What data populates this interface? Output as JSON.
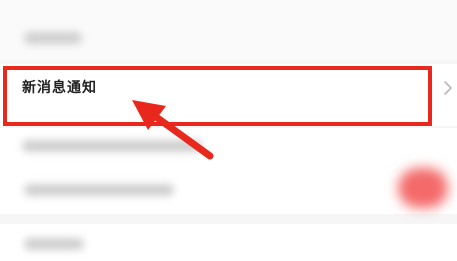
{
  "settings": {
    "notify_label": "新消息通知"
  },
  "colors": {
    "highlight": "#e8281c",
    "toggle_on": "#f46a6a"
  },
  "icons": {
    "chevron": "chevron-right-icon",
    "arrow": "red-pointer-arrow-icon"
  }
}
